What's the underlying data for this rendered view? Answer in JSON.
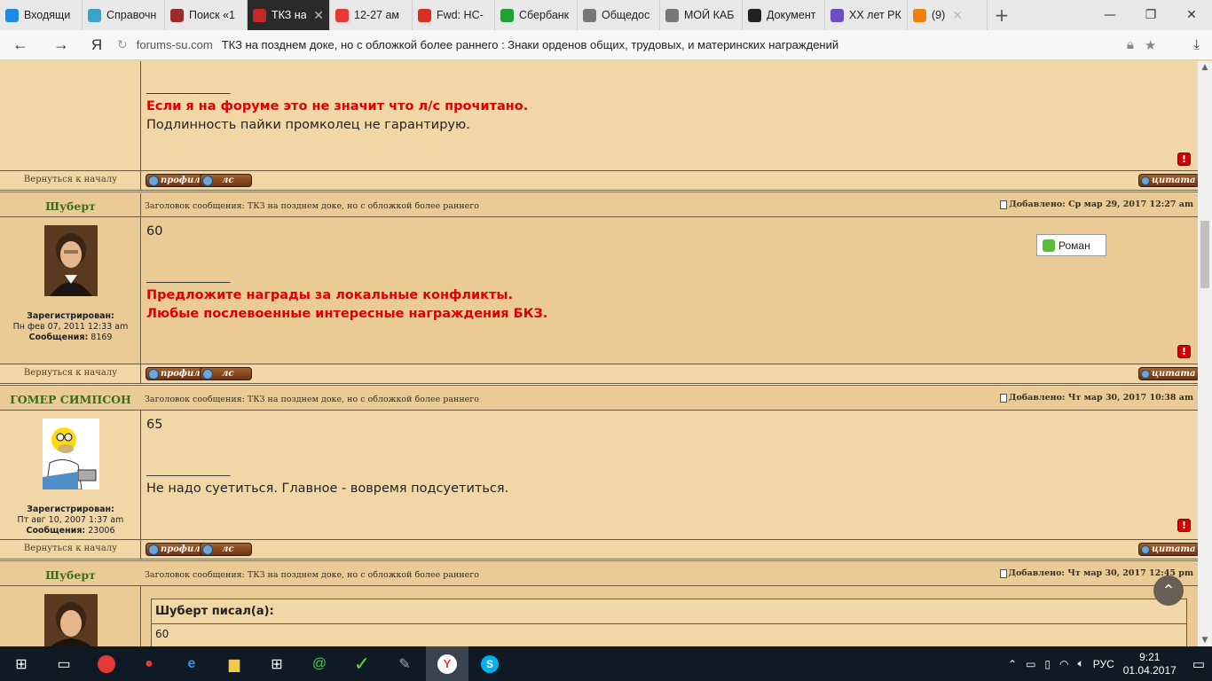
{
  "browser": {
    "tabs": [
      {
        "label": "Входящи",
        "favicon_color": "#1e88e5",
        "active": false
      },
      {
        "label": "Справочн",
        "favicon_color": "#3aa3c9",
        "active": false
      },
      {
        "label": "Поиск «1",
        "favicon_color": "#9c2b2b",
        "active": false
      },
      {
        "label": "ТКЗ на",
        "favicon_color": "#c62828",
        "active": true
      },
      {
        "label": "12-27 ам",
        "favicon_color": "#e53935",
        "active": false
      },
      {
        "label": "Fwd: НС-",
        "favicon_color": "#d93025",
        "active": false
      },
      {
        "label": "Сбербанк",
        "favicon_color": "#21a038",
        "active": false
      },
      {
        "label": "Общедос",
        "favicon_color": "#777777",
        "active": false
      },
      {
        "label": "МОЙ КАБ",
        "favicon_color": "#777777",
        "active": false
      },
      {
        "label": "Документ",
        "favicon_color": "#222222",
        "active": false
      },
      {
        "label": "XX лет РК",
        "favicon_color": "#6a4ec2",
        "active": false
      },
      {
        "label": "(9)",
        "favicon_color": "#ee8208",
        "active": false
      }
    ],
    "address": {
      "host": "forums-su.com",
      "title": "ТКЗ на позднем доке, но с обложкой более раннего : Знаки орденов общих, трудовых, и материнских награждений"
    }
  },
  "thread_subject_prefix": "Заголовок сообщения:",
  "thread_subject": "ТКЗ на позднем доке, но с обложкой более раннего",
  "back_to_top": "Вернуться к началу",
  "buttons": {
    "profile": "профиль",
    "pm": "лс",
    "quote": "цитата"
  },
  "reg_label": "Зарегистрирован:",
  "posts_label": "Сообщения:",
  "posts": [
    {
      "signature_line1": "Если я на форуме это не значит что л/с прочитано.",
      "signature_line2": "Подлинность пайки промколец не гарантирую."
    },
    {
      "author": "Шуберт",
      "posted": "Добавлено: Ср мар 29, 2017 12:27 am",
      "body": "60",
      "registered": "Пн фев 07, 2011 12:33 am",
      "posts_count": "8169",
      "signature_line1": "Предложите награды за локальные конфликты.",
      "signature_line2": "Любые послевоенные интересные награждения БКЗ.",
      "avatar": "portrait"
    },
    {
      "author": "ГОМЕР СИМПСОН",
      "posted": "Добавлено: Чт мар 30, 2017 10:38 am",
      "body": "65",
      "registered": "Пт авг 10, 2007 1:37 am",
      "posts_count": "23006",
      "signature_line1": "Не надо суетиться. Главное - вовремя подсуетиться.",
      "avatar": "homer"
    },
    {
      "author": "Шуберт",
      "posted": "Добавлено: Чт мар 30, 2017 12:45 pm",
      "quote_author": "Шуберт писал(а):",
      "quote_body": "60",
      "avatar": "portrait"
    }
  ],
  "tooltip": "Роман",
  "taskbar": {
    "lang": "РУС",
    "time": "9:21",
    "date": "01.04.2017"
  },
  "colors": {
    "page_bg": "#f2d7a6",
    "header_bg": "#eacb95",
    "signature_red": "#e00000",
    "author_green": "#3d6a1c"
  }
}
